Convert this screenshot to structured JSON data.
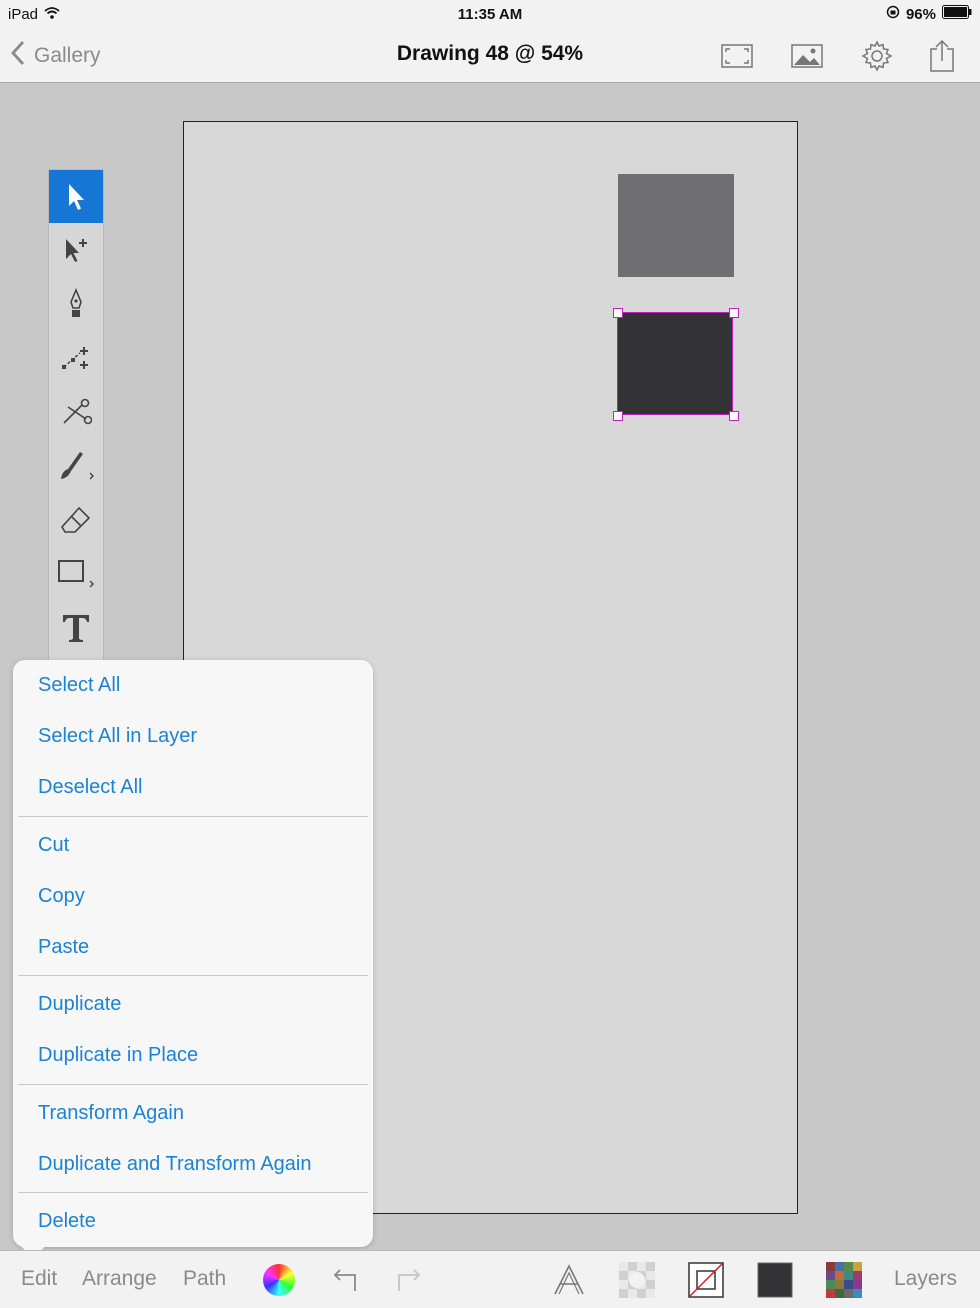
{
  "status": {
    "device": "iPad",
    "time": "11:35 AM",
    "battery": "96%"
  },
  "nav": {
    "back_label": "Gallery",
    "title": "Drawing 48 @ 54%",
    "icons": [
      "fullscreen-icon",
      "image-icon",
      "gear-icon",
      "share-icon"
    ]
  },
  "tools": [
    "select-tool-icon",
    "direct-select-tool-icon",
    "pen-tool-icon",
    "add-anchor-tool-icon",
    "scissors-tool-icon",
    "brush-tool-icon",
    "eraser-tool-icon",
    "rectangle-tool-icon",
    "text-tool-icon"
  ],
  "edit_menu": {
    "select_all": "Select All",
    "select_all_in_layer": "Select All in Layer",
    "deselect_all": "Deselect All",
    "cut": "Cut",
    "copy": "Copy",
    "paste": "Paste",
    "duplicate": "Duplicate",
    "duplicate_in_place": "Duplicate in Place",
    "transform_again": "Transform Again",
    "duplicate_and_transform_again": "Duplicate and Transform Again",
    "delete": "Delete"
  },
  "bottom": {
    "edit": "Edit",
    "arrange": "Arrange",
    "path": "Path",
    "layers": "Layers"
  },
  "colors": {
    "accent": "#1576d6",
    "menu_text": "#1a83d6",
    "shape_light": "#6f6e70",
    "shape_dark": "#333234",
    "selection": "#c020c0"
  }
}
